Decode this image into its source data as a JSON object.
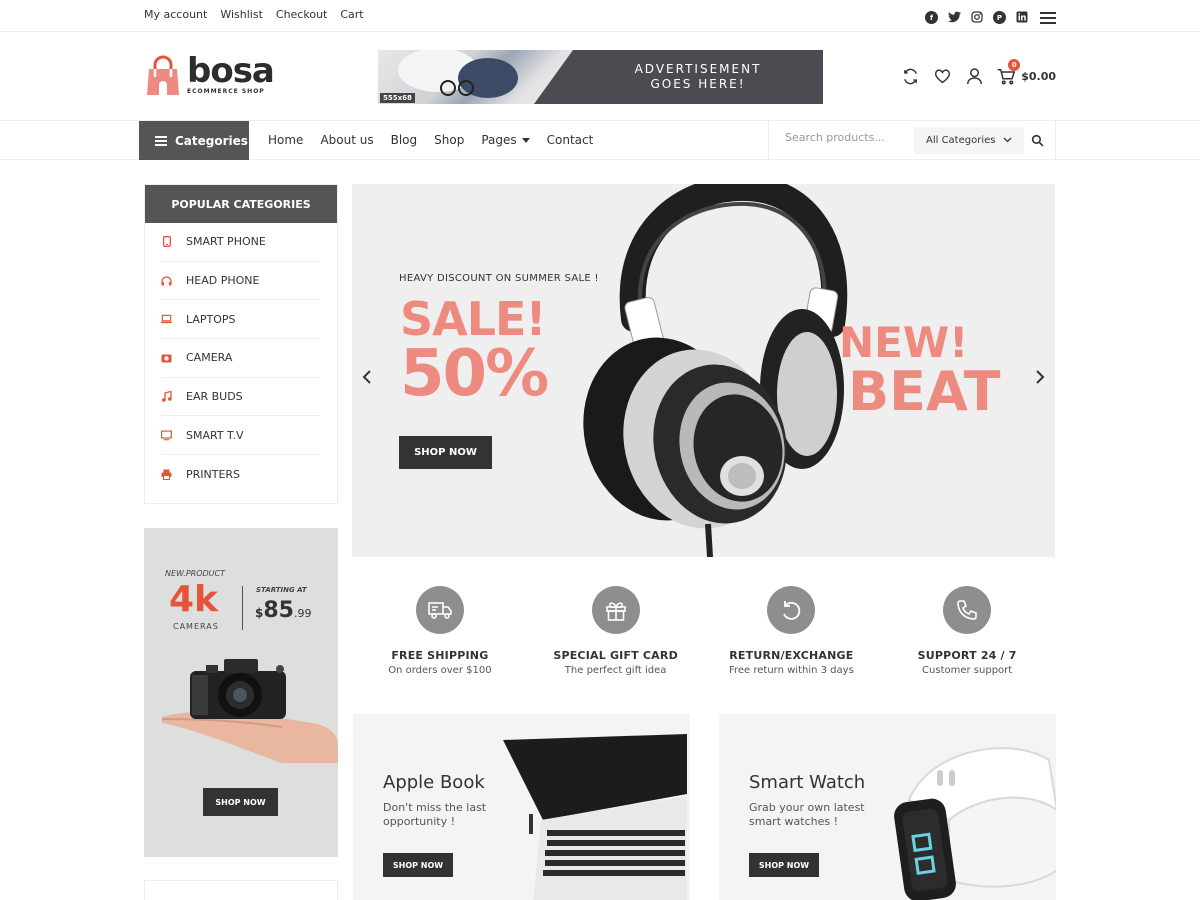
{
  "topbar": {
    "links": [
      "My account",
      "Wishlist",
      "Checkout",
      "Cart"
    ],
    "social_icons": [
      "facebook-icon",
      "twitter-icon",
      "instagram-icon",
      "pinterest-icon",
      "linkedin-icon"
    ]
  },
  "header": {
    "logo_word": "bosa",
    "logo_sub": "ECOMMERCE SHOP",
    "ad_size": "555x68",
    "ad_text_line1": "ADVERTISEMENT",
    "ad_text_line2": "GOES HERE!",
    "cart_count": "0",
    "cart_total": "$0.00",
    "icons": [
      "compare-icon",
      "wishlist-heart-icon",
      "user-icon",
      "cart-icon"
    ]
  },
  "nav": {
    "categories_label": "Categories",
    "menu": [
      {
        "label": "Home"
      },
      {
        "label": "About us"
      },
      {
        "label": "Blog"
      },
      {
        "label": "Shop"
      },
      {
        "label": "Pages",
        "dropdown": true
      },
      {
        "label": "Contact"
      }
    ],
    "search_placeholder": "Search products...",
    "category_select": "All Categories"
  },
  "sidebar": {
    "popular_title": "POPULAR CATEGORIES",
    "categories": [
      {
        "label": "SMART PHONE",
        "icon": "smartphone-icon"
      },
      {
        "label": "HEAD PHONE",
        "icon": "headphone-icon"
      },
      {
        "label": "LAPTOPS",
        "icon": "laptop-icon"
      },
      {
        "label": "CAMERA",
        "icon": "camera-icon"
      },
      {
        "label": "EAR BUDS",
        "icon": "music-note-icon"
      },
      {
        "label": "SMART T.V",
        "icon": "tv-icon"
      },
      {
        "label": "PRINTERS",
        "icon": "printer-icon"
      }
    ],
    "promo": {
      "tag": "NEW.PRODUCT",
      "headline": "4k",
      "sub": "CAMERAS",
      "starting_at": "STARTING AT",
      "currency": "$",
      "price": "85",
      "cents": ".99",
      "button": "SHOP NOW"
    }
  },
  "slider": {
    "subtitle": "HEAVY DISCOUNT ON SUMMER SALE !",
    "sale": "SALE!",
    "percent": "50%",
    "button": "SHOP NOW",
    "new": "NEW!",
    "beat": "BEAT",
    "prev": "‹",
    "next": "›"
  },
  "features": [
    {
      "title": "FREE SHIPPING",
      "sub": "On orders over $100",
      "icon": "truck-icon"
    },
    {
      "title": "SPECIAL GIFT CARD",
      "sub": "The perfect gift idea",
      "icon": "gift-icon"
    },
    {
      "title": "RETURN/EXCHANGE",
      "sub": "Free return within 3 days",
      "icon": "return-icon"
    },
    {
      "title": "SUPPORT 24 / 7",
      "sub": "Customer support",
      "icon": "phone-icon"
    }
  ],
  "banners": [
    {
      "title": "Apple Book",
      "desc": "Don't miss the last opportunity !",
      "button": "SHOP NOW"
    },
    {
      "title": "Smart Watch",
      "desc": "Grab your own latest smart watches !",
      "button": "SHOP NOW"
    }
  ],
  "colors": {
    "accent": "#e5543a",
    "dark": "#333333",
    "panel": "#555558",
    "sale_pink": "#ee8b80"
  }
}
